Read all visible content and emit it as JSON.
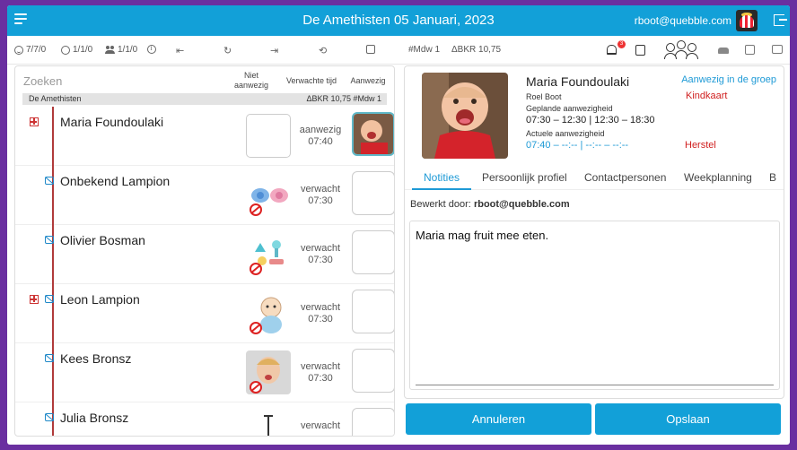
{
  "header": {
    "title": "De Amethisten 05 Januari, 2023",
    "user_email": "rboot@quebble.com"
  },
  "toolbar": {
    "present_count": "7/7/0",
    "registered_count": "1/1/0",
    "staff_count": "1/1/0",
    "mdw": "#Mdw 1",
    "bkr": "ΔBKR 10,75",
    "notification_count": "3"
  },
  "list": {
    "search_placeholder": "Zoeken",
    "col_niet": "Niet aanwezig",
    "col_verwacht": "Verwachte tijd",
    "col_aanwezig": "Aanwezig",
    "group_name": "De Amethisten",
    "group_stats": "ΔBKR 10,75 #Mdw 1",
    "children": [
      {
        "name": "Maria Foundoulaki",
        "status": "aanwezig",
        "time": "07:40"
      },
      {
        "name": "Onbekend Lampion",
        "status": "verwacht",
        "time": "07:30"
      },
      {
        "name": "Olivier Bosman",
        "status": "verwacht",
        "time": "07:30"
      },
      {
        "name": "Leon Lampion",
        "status": "verwacht",
        "time": "07:30"
      },
      {
        "name": "Kees Bronsz",
        "status": "verwacht",
        "time": "07:30"
      },
      {
        "name": "Julia Bronsz",
        "status": "verwacht",
        "time": ""
      }
    ]
  },
  "detail": {
    "name": "Maria Foundoulaki",
    "mentor": "Roel Boot",
    "planned_label": "Geplande aanwezigheid",
    "planned_time": "07:30 – 12:30 | 12:30 – 18:30",
    "actual_label": "Actuele aanwezigheid",
    "actual_time": "07:40 – --:-- | --:-- – --:--",
    "herstel": "Herstel",
    "aanwezig_link": "Aanwezig in de groep",
    "kindkaart": "Kindkaart",
    "tabs": [
      "Notities",
      "Persoonlijk profiel",
      "Contactpersonen",
      "Weekplanning",
      "B"
    ],
    "edited_by_label": "Bewerkt door:",
    "edited_by_value": "rboot@quebble.com",
    "note_text": "Maria mag fruit mee eten.",
    "cancel_label": "Annuleren",
    "save_label": "Opslaan"
  }
}
